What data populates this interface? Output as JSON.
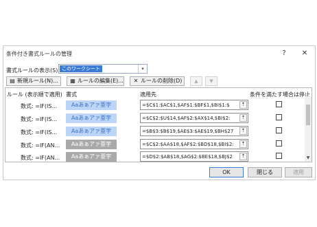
{
  "dialog": {
    "title": "条件付き書式ルールの管理",
    "help": "?",
    "close": "✕"
  },
  "scope": {
    "label": "書式ルールの表示(S):",
    "value": "このワークシート"
  },
  "toolbar": {
    "new_rule": "新規ルール(N)...",
    "edit_rule": "ルールの編集(E)...",
    "delete_rule": "ルールの削除(D)",
    "move_up": "▲",
    "move_down": "▼"
  },
  "table": {
    "headers": {
      "rule": "ルール (表示順で適用)",
      "format": "書式",
      "applies_to": "適用先",
      "stop_if_true": "条件を満たす場合は停止"
    },
    "rows": [
      {
        "rule": "数式: =IF(IS...",
        "preview": "Aaあぁアァ亜宇",
        "preview_style": "blue",
        "applies_to": "=$C$1:$AC$1,$AF$1:$BF$1,$BI$1:$",
        "stop": false
      },
      {
        "rule": "数式: =IF(IS...",
        "preview": "Aaあぁアァ亜宇",
        "preview_style": "blue",
        "applies_to": "=$C$2:$U$14,$AF$2:$AX$14,$BI$2:",
        "stop": false
      },
      {
        "rule": "数式: =IF(IS...",
        "preview": "Aaあぁアァ亜宇",
        "preview_style": "blue",
        "applies_to": "=$B$3:$B$19,$AE$3:$AE$19,$BH$27",
        "stop": false
      },
      {
        "rule": "数式: =IF(AN...",
        "preview": "Aaあぁアァ亜宇",
        "preview_style": "gray",
        "applies_to": "=$C$2:$AA$18,$AF$2:$BD$18,$BI$2:",
        "stop": false
      },
      {
        "rule": "数式: =IF(AN...",
        "preview": "Aaあぁアァ亜宇",
        "preview_style": "gray",
        "applies_to": "=$D$2:$AB$18,$AG$2:$BE$18,$BJ$2",
        "stop": false
      }
    ]
  },
  "footer": {
    "ok": "OK",
    "close": "閉じる",
    "apply": "適用"
  },
  "colors": {
    "selected_bg": "#3a7bd5",
    "preview_blue_bg": "#bdd6f7",
    "preview_gray_bg": "#a9a9a9"
  }
}
